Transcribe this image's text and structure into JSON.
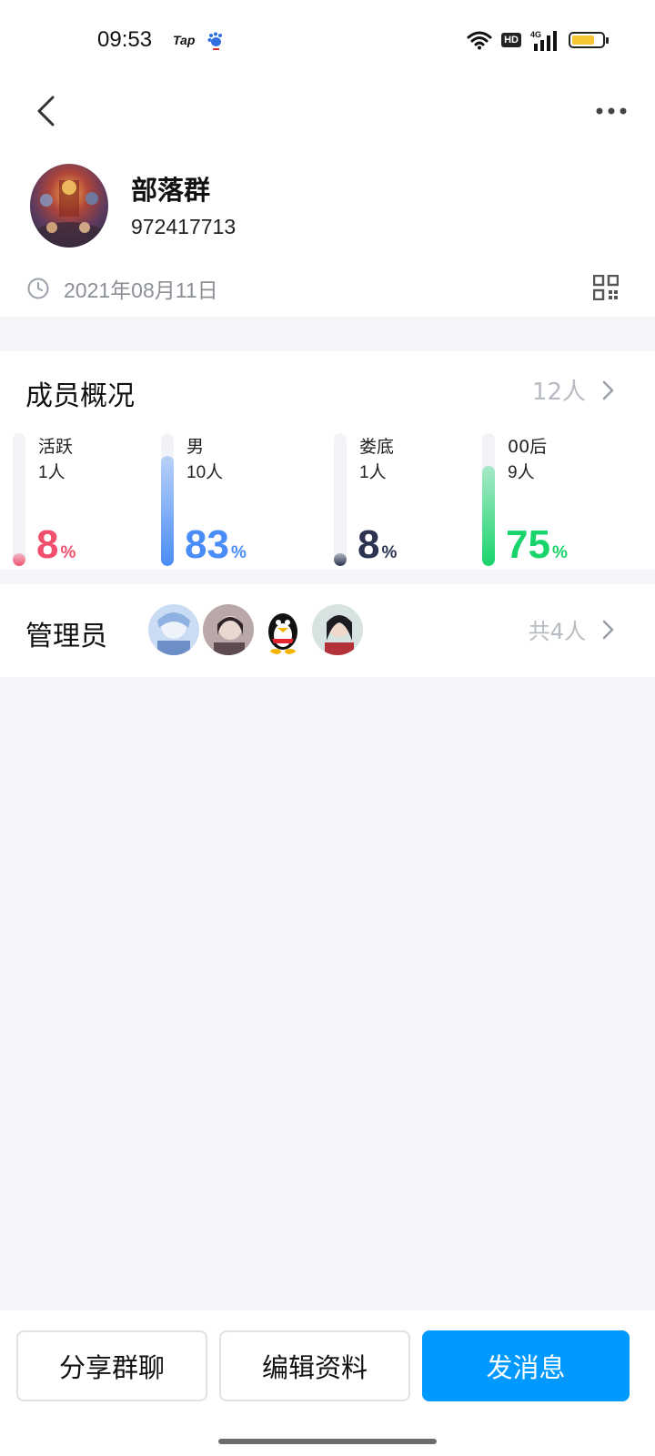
{
  "status_bar": {
    "time": "09:53",
    "tap_label": "Tap",
    "hd_label": "HD",
    "network_label": "4G",
    "battery_level": 0.75
  },
  "group": {
    "name": "部落群",
    "id": "972417713",
    "created_date": "2021年08月11日"
  },
  "members": {
    "title": "成员概况",
    "count": "12人",
    "stats": [
      {
        "label": "活跃",
        "count": "1人",
        "percent": "8",
        "percent_sign": "%",
        "fraction": 0.08,
        "color": "#f0506e"
      },
      {
        "label": "男",
        "count": "10人",
        "percent": "83",
        "percent_sign": "%",
        "fraction": 0.83,
        "color": "#4a8df8"
      },
      {
        "label": "娄底",
        "count": "1人",
        "percent": "8",
        "percent_sign": "%",
        "fraction": 0.08,
        "color": "#2c3350"
      },
      {
        "label": "00后",
        "count": "9人",
        "percent": "75",
        "percent_sign": "%",
        "fraction": 0.75,
        "color": "#19d46b"
      }
    ]
  },
  "admins": {
    "title": "管理员",
    "count": "共4人"
  },
  "actions": {
    "share": "分享群聊",
    "edit": "编辑资料",
    "send": "发消息"
  },
  "colors": {
    "primary": "#0099ff",
    "background": "#f3f5f9"
  }
}
